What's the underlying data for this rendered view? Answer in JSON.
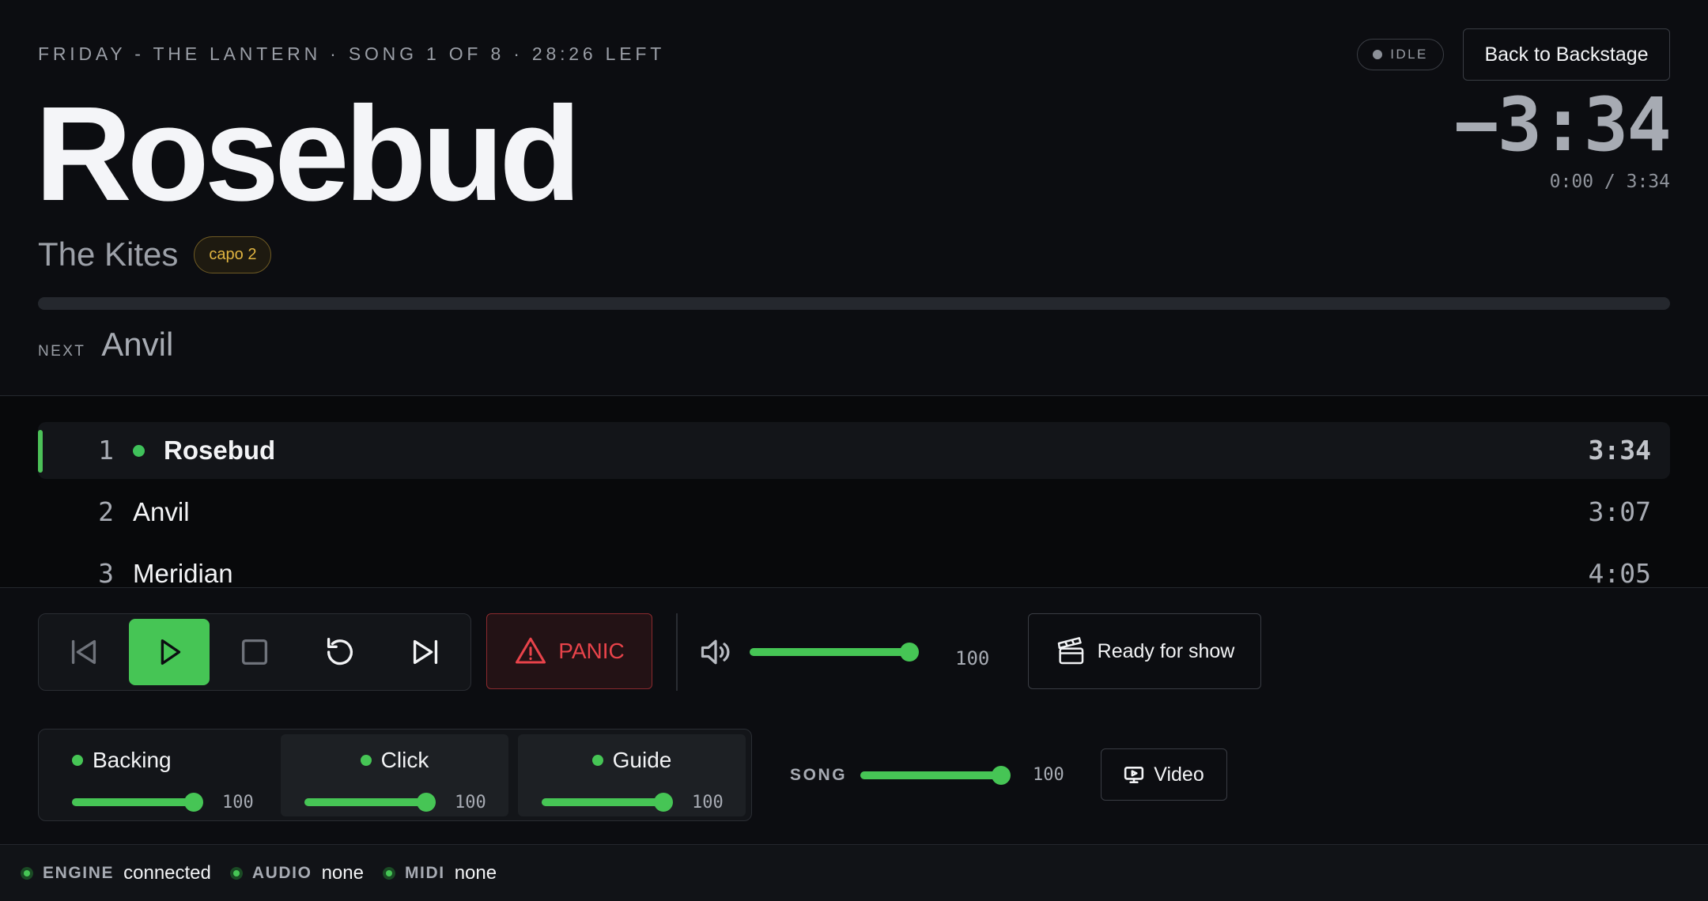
{
  "header": {
    "context": "FRIDAY - THE LANTERN · SONG 1 OF 8 · 28:26 LEFT",
    "title": "Rosebud",
    "artist": "The Kites",
    "capo": "capo 2",
    "status": "IDLE",
    "back_label": "Back to Backstage",
    "countdown": "−3:34",
    "elapsed": "0:00 / 3:34",
    "progress_fraction": 0,
    "next_label": "NEXT",
    "next_title": "Anvil"
  },
  "setlist": [
    {
      "num": "1",
      "title": "Rosebud",
      "duration": "3:34",
      "current": true
    },
    {
      "num": "2",
      "title": "Anvil",
      "duration": "3:07",
      "current": false
    },
    {
      "num": "3",
      "title": "Meridian",
      "duration": "4:05",
      "current": false
    }
  ],
  "transport": {
    "buttons": [
      "previous-track",
      "play",
      "stop",
      "restart",
      "next-track"
    ]
  },
  "panic_label": "PANIC",
  "master_volume": {
    "value": 100,
    "label": "100"
  },
  "ready_label": "Ready for show",
  "mixer": {
    "channels": [
      {
        "name": "Backing",
        "value": 100,
        "label": "100"
      },
      {
        "name": "Click",
        "value": 100,
        "label": "100"
      },
      {
        "name": "Guide",
        "value": 100,
        "label": "100"
      }
    ]
  },
  "song_volume": {
    "label": "SONG",
    "value": 100,
    "value_label": "100"
  },
  "video_label": "Video",
  "statusbar": [
    {
      "label": "ENGINE",
      "value": "connected"
    },
    {
      "label": "AUDIO",
      "value": "none"
    },
    {
      "label": "MIDI",
      "value": "none"
    }
  ],
  "colors": {
    "accent": "#46c555",
    "danger": "#e8434a",
    "capo": "#e0b441"
  }
}
